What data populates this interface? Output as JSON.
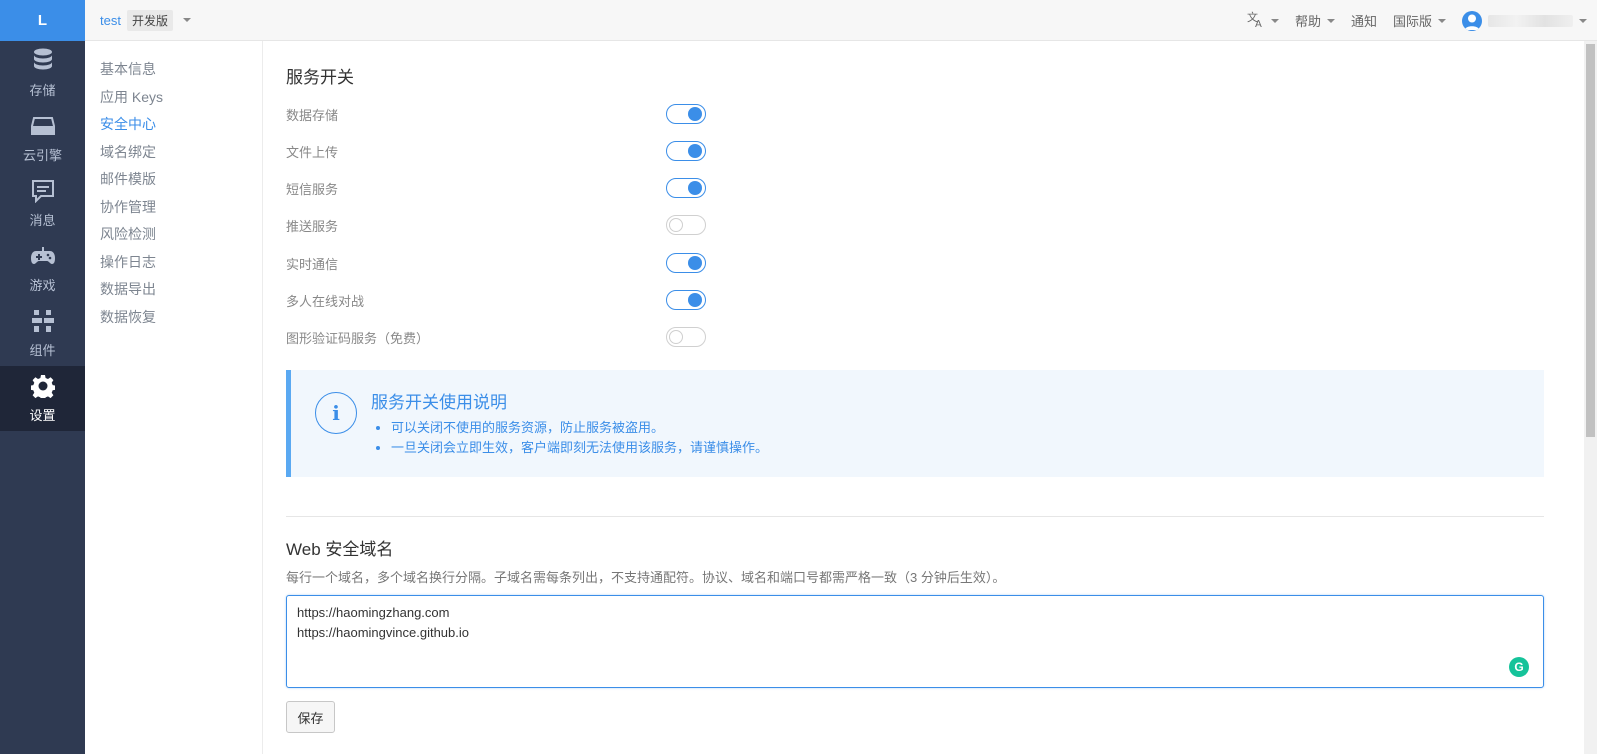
{
  "logo": "L",
  "leftnav": {
    "items": [
      {
        "label": "存储",
        "icon": "database-icon"
      },
      {
        "label": "云引擎",
        "icon": "server-icon"
      },
      {
        "label": "消息",
        "icon": "message-icon"
      },
      {
        "label": "游戏",
        "icon": "gamepad-icon"
      },
      {
        "label": "组件",
        "icon": "components-icon"
      },
      {
        "label": "设置",
        "icon": "gear-icon"
      }
    ],
    "active": "设置"
  },
  "topbar": {
    "app_name": "test",
    "env_badge": "开发版",
    "translate_icon": "translate-icon",
    "help": "帮助",
    "notify": "通知",
    "region": "国际版"
  },
  "subnav": {
    "items": [
      "基本信息",
      "应用 Keys",
      "安全中心",
      "域名绑定",
      "邮件模版",
      "协作管理",
      "风险检测",
      "操作日志",
      "数据导出",
      "数据恢复"
    ],
    "active": "安全中心"
  },
  "services": {
    "title": "服务开关",
    "items": [
      {
        "label": "数据存储",
        "on": true
      },
      {
        "label": "文件上传",
        "on": true
      },
      {
        "label": "短信服务",
        "on": true
      },
      {
        "label": "推送服务",
        "on": false
      },
      {
        "label": "实时通信",
        "on": true
      },
      {
        "label": "多人在线对战",
        "on": true
      },
      {
        "label": "图形验证码服务（免费）",
        "on": false
      }
    ]
  },
  "info": {
    "title": "服务开关使用说明",
    "bullets": [
      "可以关闭不使用的服务资源，防止服务被盗用。",
      "一旦关闭会立即生效，客户端即刻无法使用该服务，请谨慎操作。"
    ]
  },
  "web_domains": {
    "title": "Web 安全域名",
    "description": "每行一个域名，多个域名换行分隔。子域名需每条列出，不支持通配符。协议、域名和端口号都需严格一致（3 分钟后生效）。",
    "value": "https://haomingzhang.com\nhttps://haomingvince.github.io",
    "save_label": "保存"
  },
  "colors": {
    "accent": "#3b8ee8",
    "sidebar": "#2f3a52",
    "sidebar_active": "#1f2638",
    "info_bg": "#f1f7fd"
  }
}
